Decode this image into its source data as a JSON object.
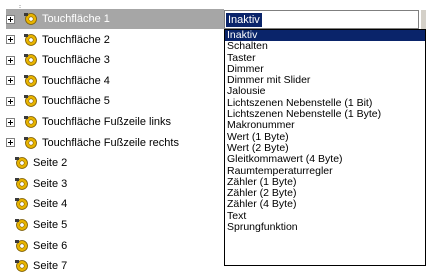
{
  "tree": {
    "items": [
      {
        "label": "Touchfläche 1",
        "expandable": true,
        "selected": true
      },
      {
        "label": "Touchfläche 2",
        "expandable": true,
        "selected": false
      },
      {
        "label": "Touchfläche 3",
        "expandable": true,
        "selected": false
      },
      {
        "label": "Touchfläche 4",
        "expandable": true,
        "selected": false
      },
      {
        "label": "Touchfläche 5",
        "expandable": true,
        "selected": false
      },
      {
        "label": "Touchfläche Fußzeile links",
        "expandable": true,
        "selected": false
      },
      {
        "label": "Touchfläche Fußzeile rechts",
        "expandable": true,
        "selected": false
      },
      {
        "label": "Seite 2",
        "expandable": false,
        "selected": false
      },
      {
        "label": "Seite 3",
        "expandable": false,
        "selected": false
      },
      {
        "label": "Seite 4",
        "expandable": false,
        "selected": false
      },
      {
        "label": "Seite 5",
        "expandable": false,
        "selected": false
      },
      {
        "label": "Seite 6",
        "expandable": false,
        "selected": false
      },
      {
        "label": "Seite 7",
        "expandable": false,
        "selected": false
      }
    ]
  },
  "combo": {
    "value": "Inaktiv",
    "options": [
      "Inaktiv",
      "Schalten",
      "Taster",
      "Dimmer",
      "Dimmer mit Slider",
      "Jalousie",
      "Lichtszenen Nebenstelle (1 Bit)",
      "Lichtszenen Nebenstelle (1 Byte)",
      "Makronummer",
      "Wert (1 Byte)",
      "Wert (2 Byte)",
      "Gleitkommawert (4 Byte)",
      "Raumtemperaturregler",
      "Zähler (1 Byte)",
      "Zähler (2 Byte)",
      "Zähler (4 Byte)",
      "Text",
      "Sprungfunktion"
    ],
    "selected_index": 0
  },
  "colors": {
    "selection": "#0a246a",
    "tree_selection": "#a6a6a6",
    "gear": "#e8b400"
  }
}
